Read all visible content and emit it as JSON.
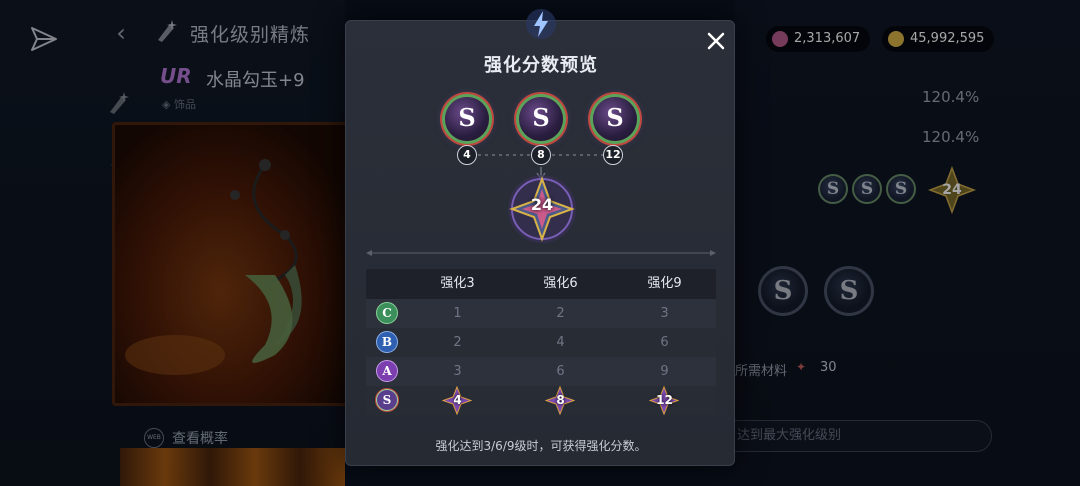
{
  "page": {
    "title": "强化级别精炼",
    "item_rarity": "UR",
    "item_name": "水晶勾玉+9",
    "item_type": "饰品",
    "probability_link": "查看概率",
    "probability_icon_text": "WEB"
  },
  "currencies": [
    {
      "name": "gem",
      "value": "2,313,607",
      "color": "#b65a8c"
    },
    {
      "name": "gold",
      "value": "45,992,595",
      "color": "#d9b347"
    }
  ],
  "stats": {
    "value_1": "120.4%",
    "value_2": "120.4%",
    "mini_orbs": [
      "S",
      "S",
      "S"
    ],
    "mini_star_value": "24",
    "big_orbs": [
      "S",
      "S"
    ],
    "required_materials_label": "所需材料",
    "required_materials_count": "30",
    "max_level_button": "达到最大强化级别"
  },
  "modal": {
    "title": "强化分数预览",
    "orbs": [
      {
        "grade": "S",
        "step": "4"
      },
      {
        "grade": "S",
        "step": "8"
      },
      {
        "grade": "S",
        "step": "12"
      }
    ],
    "total_score": "24",
    "table": {
      "headers": [
        "强化3",
        "强化6",
        "强化9"
      ],
      "rows": [
        {
          "grade": "C",
          "color": "#3b8f5a",
          "values": [
            "1",
            "2",
            "3"
          ]
        },
        {
          "grade": "B",
          "color": "#2f5fb0",
          "values": [
            "2",
            "4",
            "6"
          ]
        },
        {
          "grade": "A",
          "color": "#7b3fb0",
          "values": [
            "3",
            "6",
            "9"
          ]
        },
        {
          "grade": "S",
          "color": "#5a3e8e",
          "values": [
            "4",
            "8",
            "12"
          ]
        }
      ]
    },
    "footnote": "强化达到3/6/9级时，可获得强化分数。"
  }
}
